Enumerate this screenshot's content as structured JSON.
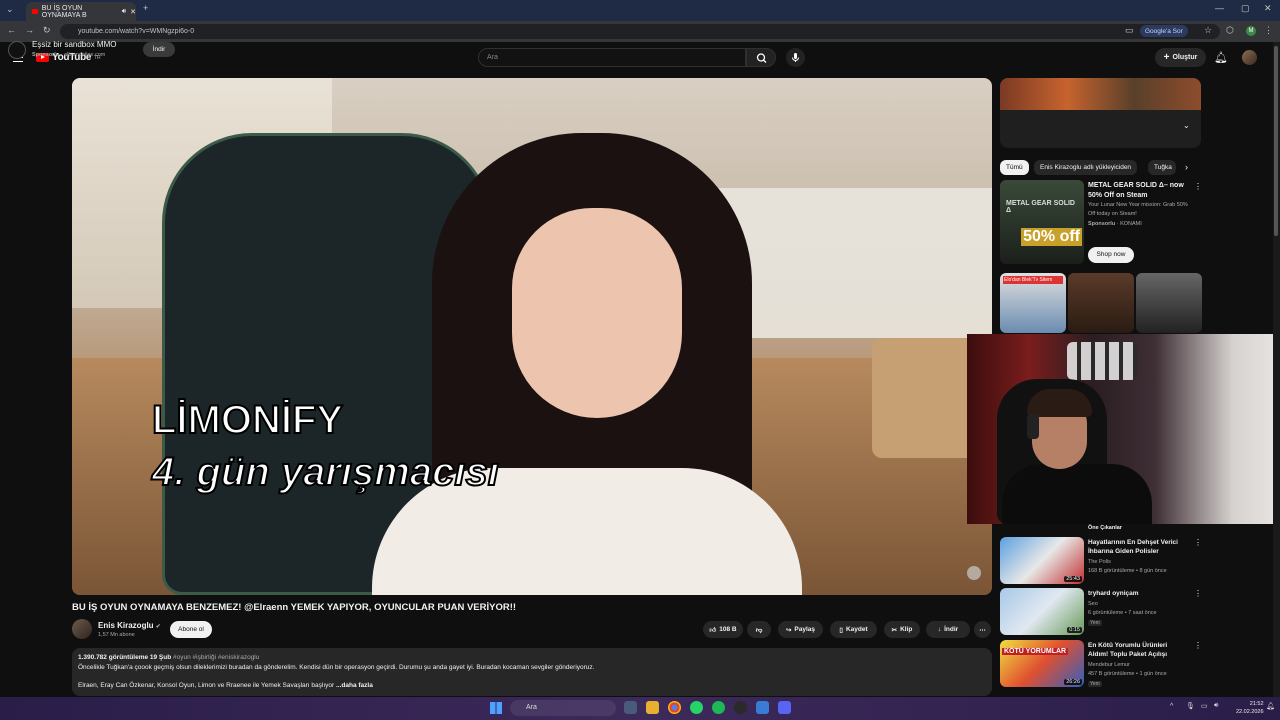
{
  "browser": {
    "tab_title": "BU İŞ OYUN OYNAMAYA B",
    "url": "youtube.com/watch?v=WMNgzpi6o-0",
    "google_ask": "Google'a Sor",
    "profile_initial": "M"
  },
  "header": {
    "logo_text": "YouTube",
    "logo_sup": "TR",
    "search_placeholder": "Ara",
    "create_label": "Oluştur"
  },
  "video": {
    "subtitle_line1": "LİMONİFY",
    "subtitle_line2": "4. gün yarışmacısı",
    "title": "BU İŞ OYUN OYNAMAYA BENZEMEZ! @Elraenn YEMEK YAPIYOR, OYUNCULAR PUAN VERİYOR!!",
    "channel_name": "Enis Kirazoglu",
    "subscribers": "1,57 Mn abone",
    "subscribe_label": "Abone ol",
    "likes": "108 B",
    "share_label": "Paylaş",
    "save_label": "Kaydet",
    "clip_label": "Klip",
    "download_label": "İndir",
    "views_date": "1.390.782 görüntüleme  19 Şub",
    "hashtags": "#oyun #işbirliği #eniskirazoglu",
    "desc_line1": "Öncelikle Tuğkan'a çoook geçmiş olsun dileklerimizi buradan da gönderelim. Kendisi dün bir operasyon geçirdi. Durumu şu anda gayet iyi. Buradan kocaman sevgiler gönderiyoruz.",
    "desc_line2": "Elraen, Eray Can Özkenar, Konsol Oyun, Limon ve Rraenee ile Yemek Savaşları başlıyor",
    "more_label": "...daha fazla"
  },
  "sidebar": {
    "ad": {
      "title": "Eşsiz bir sandbox MMO",
      "sponsor": "Sponsorlu",
      "domain": "albiononline.com",
      "download_label": "İndir"
    },
    "chips": [
      "Tümü",
      "Enis Kirazoglu adlı yükleyiciden",
      "Tuğka"
    ],
    "promo": {
      "title": "METAL GEAR SOLID Δ– now 50% Off on Steam",
      "desc": "Your Lunar New Year mission: Grab 50% Off today on Steam!",
      "sponsor": "Sponsorlu",
      "publisher": "KONAMI",
      "cta": "Shop now",
      "badge": "50% off",
      "thumb_text": "METAL GEAR SOLID Δ"
    },
    "short_label": "Elo'dan Blek'Tv Sitem",
    "recs": [
      {
        "title": "Öne Çıkanlar",
        "meta": "",
        "duration": "",
        "new": ""
      },
      {
        "title": "Hayatlarının En Dehşet Verici İhbarına Giden Polisler",
        "channel": "The Polis",
        "meta": "168 B görüntüleme • 8 gün önce",
        "duration": "25:43",
        "new": ""
      },
      {
        "title": "tryhard oyniçam",
        "channel": "Seo",
        "meta": "6 görüntüleme • 7 saat önce",
        "duration": "0:15",
        "new": "Yeni"
      },
      {
        "title": "En Kötü Yorumlu Ürünleri Aldım! Toplu Paket Açılışı",
        "channel": "Mendebur Lemur",
        "meta": "457 B görüntüleme • 1 gün önce",
        "duration": "26:26",
        "new": "Yeni",
        "thumb_text": "KÖTÜ YORUMLAR"
      }
    ]
  },
  "taskbar": {
    "search_placeholder": "Ara",
    "time": "21:52",
    "date": "22.02.2026"
  }
}
